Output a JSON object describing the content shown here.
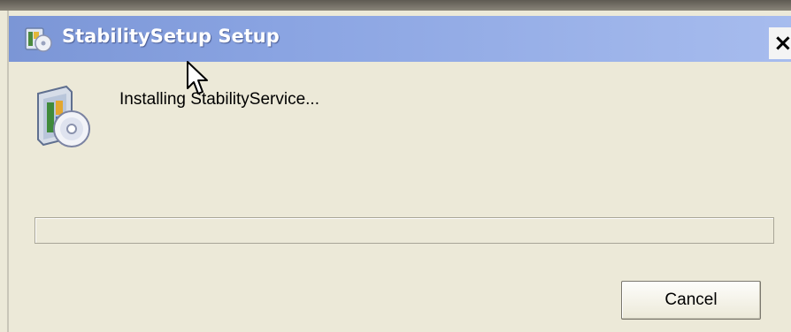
{
  "window": {
    "title": "StabilitySetup Setup",
    "close_label": "×"
  },
  "main": {
    "status_text": "Installing StabilityService...",
    "progress_value": 0
  },
  "buttons": {
    "cancel_label": "Cancel"
  },
  "icons": {
    "title_icon": "setup-installer-icon",
    "main_icon": "setup-installer-icon",
    "close_icon": "close-icon",
    "cursor": "mouse-pointer-icon"
  },
  "colors": {
    "titlebar_start": "#7b96d6",
    "titlebar_end": "#a7bcee",
    "dialog_background": "#ece9d8",
    "progress_fill": "#2f9a3a"
  }
}
